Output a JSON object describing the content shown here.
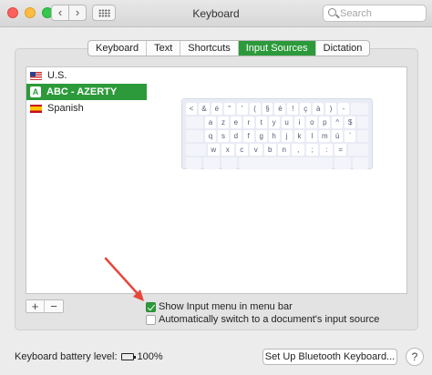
{
  "window": {
    "title": "Keyboard",
    "search_placeholder": "Search",
    "back_glyph": "‹",
    "forward_glyph": "›"
  },
  "tabs": [
    {
      "label": "Keyboard",
      "active": false
    },
    {
      "label": "Text",
      "active": false
    },
    {
      "label": "Shortcuts",
      "active": false
    },
    {
      "label": "Input Sources",
      "active": true
    },
    {
      "label": "Dictation",
      "active": false
    }
  ],
  "sources": [
    {
      "label": "U.S.",
      "icon": "us-flag-icon",
      "selected": false
    },
    {
      "label": "ABC - AZERTY",
      "icon": "letter-a-icon",
      "icon_glyph": "A",
      "selected": true
    },
    {
      "label": "Spanish",
      "icon": "spain-flag-icon",
      "selected": false
    }
  ],
  "keyboard_rows": [
    [
      "<",
      "&",
      "é",
      "\"",
      "'",
      "(",
      "§",
      "è",
      "!",
      "ç",
      "à",
      ")",
      "-"
    ],
    [
      "a",
      "z",
      "e",
      "r",
      "t",
      "y",
      "u",
      "i",
      "o",
      "p",
      "^",
      "$"
    ],
    [
      "q",
      "s",
      "d",
      "f",
      "g",
      "h",
      "j",
      "k",
      "l",
      "m",
      "ù",
      "`"
    ],
    [
      "w",
      "x",
      "c",
      "v",
      "b",
      "n",
      ",",
      ";",
      ":",
      "="
    ]
  ],
  "list_buttons": {
    "add": "+",
    "remove": "−"
  },
  "checkboxes": [
    {
      "label": "Show Input menu in menu bar",
      "checked": true
    },
    {
      "label": "Automatically switch to a document's input source",
      "checked": false
    }
  ],
  "battery": {
    "label": "Keyboard battery level:",
    "value": "100%",
    "level": 1.0
  },
  "bluetooth_button": "Set Up Bluetooth Keyboard...",
  "help_button": "?",
  "colors": {
    "accent": "#2c9a3a",
    "arrow": "#e8463c"
  }
}
